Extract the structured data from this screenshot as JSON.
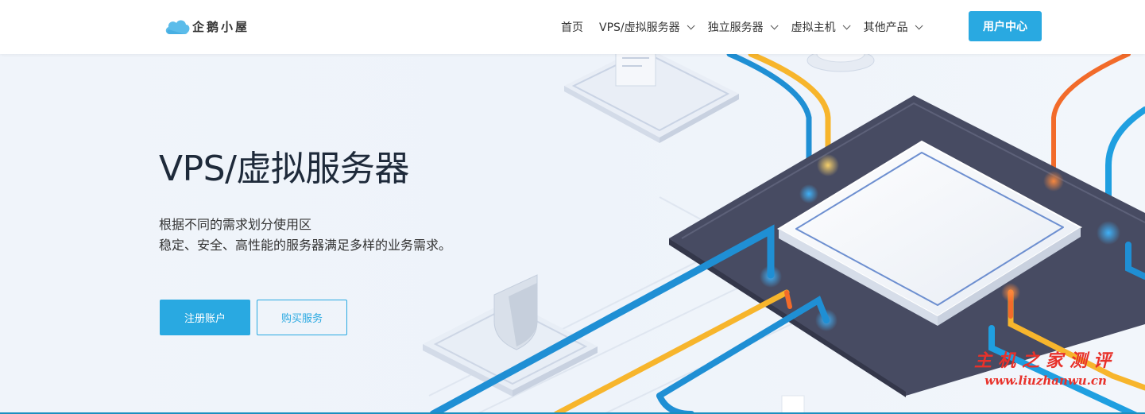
{
  "brand": {
    "name": "企鹅小屋"
  },
  "nav": {
    "items": [
      {
        "label": "首页",
        "dropdown": false
      },
      {
        "label": "VPS/虚拟服务器",
        "dropdown": true
      },
      {
        "label": "独立服务器",
        "dropdown": true
      },
      {
        "label": "虚拟主机",
        "dropdown": true
      },
      {
        "label": "其他产品",
        "dropdown": true
      }
    ],
    "user_center": "用户中心"
  },
  "hero": {
    "title": "VPS/虚拟服务器",
    "desc_line1": "根据不同的需求划分使用区",
    "desc_line2": "稳定、安全、高性能的服务器满足多样的业务需求。",
    "register_button": "注册账户",
    "buy_button": "购买服务"
  },
  "watermark": {
    "cn": "主机之家测评",
    "url": "www.liuzhanwu.cn"
  },
  "colors": {
    "accent": "#29a9e1",
    "chip_dark": "#4a4d63",
    "pipe_blue": "#1f8fd4",
    "pipe_yellow": "#f7b52c",
    "pipe_orange": "#f26b2a",
    "watermark": "#e8312a"
  }
}
